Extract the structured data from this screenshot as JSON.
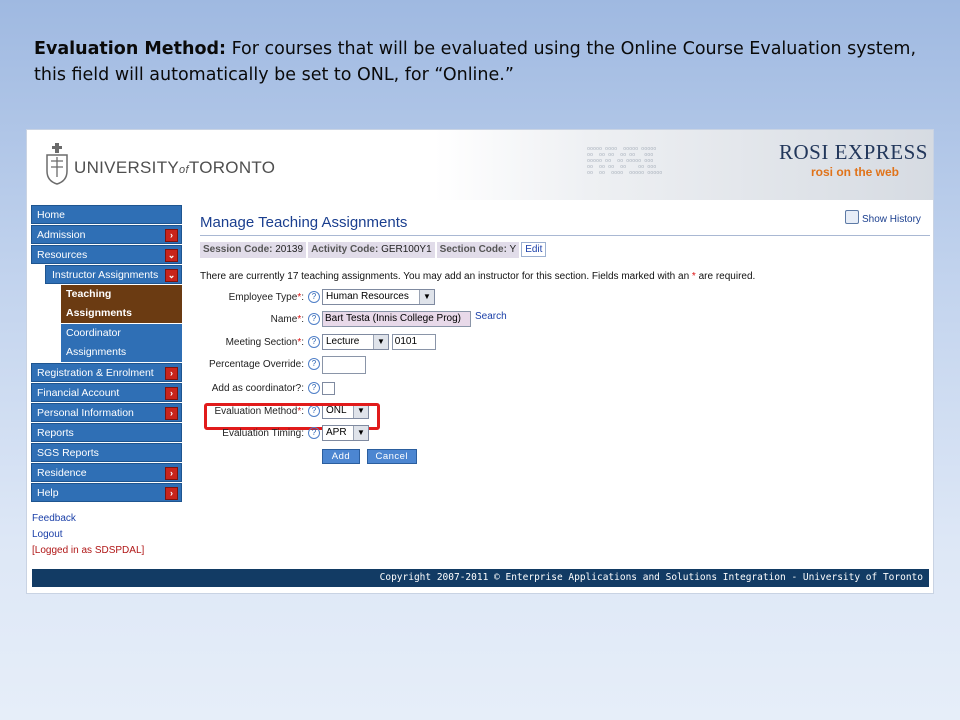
{
  "caption": {
    "label": "Evaluation Method:",
    "text": " For courses that will be evaluated using the Online Course Evaluation system, this field will automatically be set to ONL, for “Online.”"
  },
  "banner": {
    "university_left": "UNIVERSITY",
    "university_of": "of",
    "university_right": "TORONTO",
    "app_title": "ROSI EXPRESS",
    "app_subtitle": "rosi on the web"
  },
  "nav": {
    "items": [
      "Home",
      "Admission",
      "Resources"
    ],
    "sub": "Instructor Assignments",
    "active_line1": "Teaching",
    "active_line2": "Assignments",
    "inactive_line1": "Coordinator",
    "inactive_line2": "Assignments",
    "items2": [
      "Registration & Enrolment",
      "Financial Account",
      "Personal Information",
      "Reports",
      "SGS Reports",
      "Residence",
      "Help"
    ],
    "feedback": "Feedback",
    "logout": "Logout",
    "logged_in": "[Logged in as SDSPDAL]"
  },
  "page": {
    "title": "Manage Teaching Assignments",
    "show_history": "Show History",
    "session_label": "Session Code:",
    "session_value": "20139",
    "activity_label": "Activity Code:",
    "activity_value": "GER100Y1",
    "section_label": "Section Code:",
    "section_value": "Y",
    "edit": "Edit",
    "intro": "There are currently 17 teaching assignments. You may add an instructor for this section. Fields marked with an ",
    "intro_star": "*",
    "intro_end": " are required."
  },
  "form": {
    "employee_type_label": "Employee Type",
    "employee_type_value": "Human Resources",
    "name_label": "Name",
    "name_value": "Bart Testa (Innis College Prog)",
    "search": "Search",
    "meeting_section_label": "Meeting Section",
    "meeting_section_value": "Lecture",
    "meeting_section_number": "0101",
    "percentage_override_label": "Percentage Override:",
    "add_coordinator_label": "Add as coordinator?:",
    "evaluation_method_label": "Evaluation Method",
    "evaluation_method_value": "ONL",
    "evaluation_timing_label": "Evaluation Timing:",
    "evaluation_timing_value": "APR",
    "add_button": "Add",
    "cancel_button": "Cancel",
    "required_star": "*",
    "colon": ":",
    "help": "?"
  },
  "footer": {
    "text": "Copyright 2007-2011 © Enterprise Applications and Solutions Integration - University of Toronto"
  },
  "colors": {
    "nav_blue": "#2f6fb5",
    "nav_active": "#6b3b12",
    "highlight_red": "#e11b1b",
    "footer_navy": "#123b64"
  }
}
